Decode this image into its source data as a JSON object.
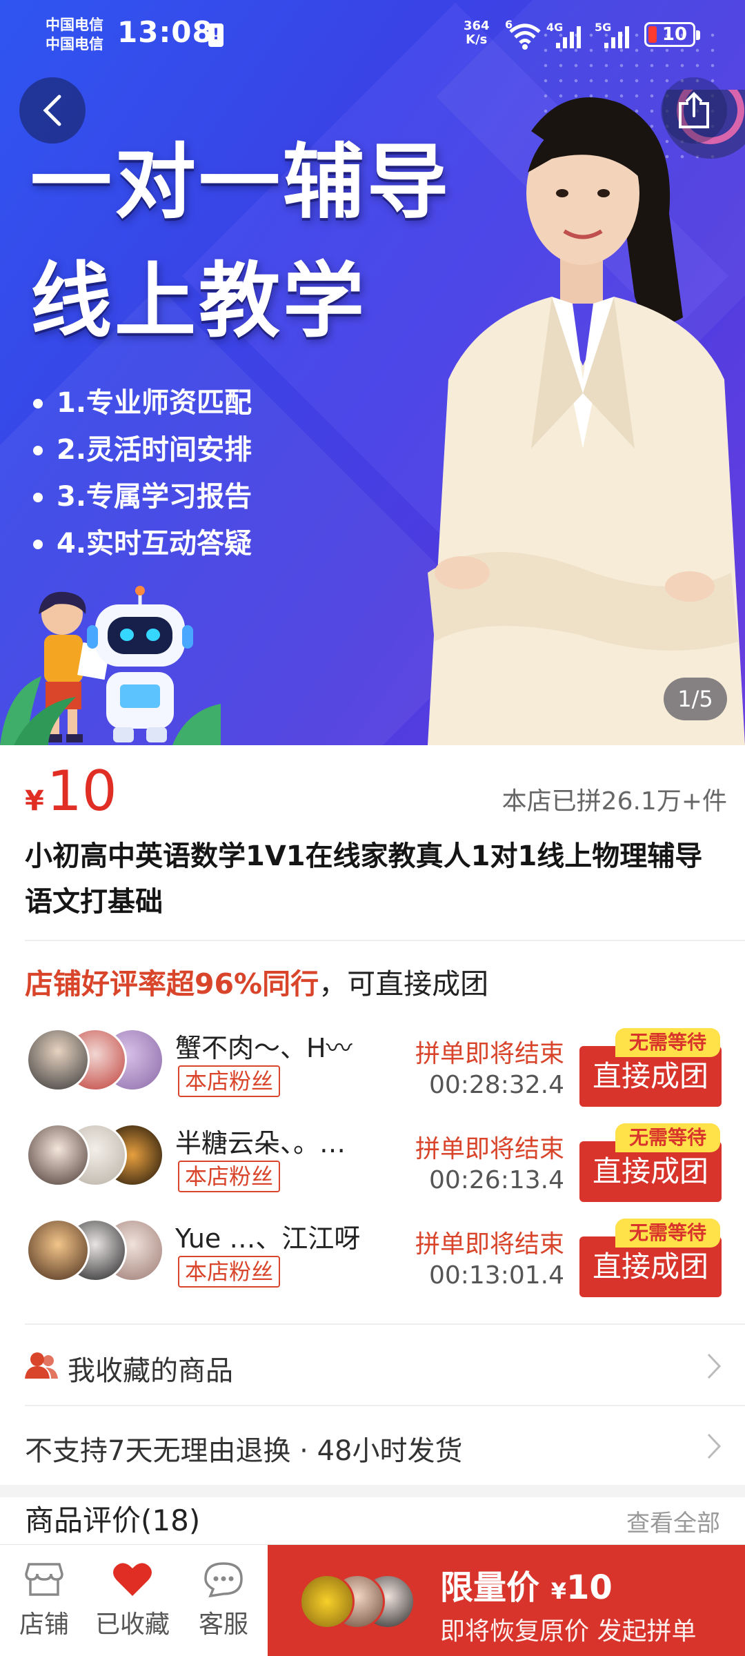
{
  "status_bar": {
    "carrier_line1": "中国电信",
    "carrier_line2": "中国电信",
    "time": "13:08",
    "alert": "!",
    "net_speed_value": "364",
    "net_speed_unit": "K/s",
    "wifi_label": "6",
    "sig1_label": "4G",
    "sig2_label": "5G",
    "battery": "10"
  },
  "banner": {
    "headline_line1": "一对一辅导",
    "headline_line2": "线上教学",
    "features": [
      "1.专业师资匹配",
      "2.灵活时间安排",
      "3.专属学习报告",
      "4.实时互动答疑"
    ],
    "pager": "1/5"
  },
  "product": {
    "currency": "¥",
    "price": "10",
    "sold": "本店已拼26.1万+件",
    "title": "小初高中英语数学1V1在线家教真人1对1线上物理辅导语文打基础"
  },
  "rating": {
    "highlight": "店铺好评率超96%同行",
    "rest": "，可直接成团"
  },
  "groups": [
    {
      "name": "蟹不肉～、H〰",
      "tag": "本店粉丝",
      "status": "拼单即将结束",
      "time": "00:28:32.4",
      "button": "直接成团",
      "badge": "无需等待"
    },
    {
      "name": "半糖云朵、。…",
      "tag": "本店粉丝",
      "status": "拼单即将结束",
      "time": "00:26:13.4",
      "button": "直接成团",
      "badge": "无需等待"
    },
    {
      "name": "Yue …、江江呀",
      "tag": "本店粉丝",
      "status": "拼单即将结束",
      "time": "00:13:01.4",
      "button": "直接成团",
      "badge": "无需等待"
    }
  ],
  "favorites_row": "我收藏的商品",
  "service_row": "不支持7天无理由退换 · 48小时发货",
  "reviews": {
    "title": "商品评价(18)",
    "see_all": "查看全部"
  },
  "bottom_bar": {
    "shop": "店铺",
    "favorited": "已收藏",
    "service": "客服",
    "buy_line1_label": "限量价",
    "buy_currency": "¥",
    "buy_price": "10",
    "buy_line2": "即将恢复原价 发起拼单"
  },
  "colors": {
    "accent_red": "#d9342b",
    "price_red": "#e02e24",
    "badge_yellow": "#ffe14a",
    "banner_blue": "#3a43e6"
  }
}
